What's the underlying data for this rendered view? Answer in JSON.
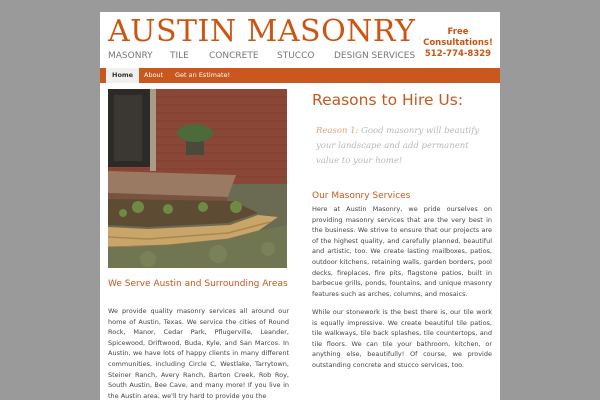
{
  "site": {
    "title": "AUSTIN MASONRY",
    "tagline": [
      "MASONRY",
      "TILE",
      "CONCRETE",
      "STUCCO",
      "DESIGN SERVICES"
    ],
    "cta": [
      "Free",
      "Consultations!",
      "512-774-8329"
    ],
    "colors": {
      "accent": "#cc5511",
      "nav_bg": "#c8581e",
      "page_bg": "#9a9a9a"
    }
  },
  "nav": {
    "items": [
      "Home",
      "About",
      "Get an Estimate!"
    ],
    "active_index": 0
  },
  "left": {
    "photo_alt": "brick planter and stone-edged garden bed",
    "heading": "We Serve Austin and Surrounding Areas",
    "body": "We provide quality masonry services all around our home of Austin, Texas. We service the cities of Round Rock, Manor, Cedar Park, Pflugerville, Leander, Spicewood, Driftwood, Buda, Kyle, and San Marcos. In Austin, we have lots of happy clients in many different communities, including Circle C, Westlake, Tarrytown, Steiner Ranch, Avery Ranch, Barton Creek, Rob Roy, South Austin, Bee Cave, and many more! If you live in the Austin area, we'll try hard to provide you the"
  },
  "right": {
    "title": "Reasons to Hire Us:",
    "reason_label": "Reason 1:",
    "reason_text": "Good masonry will beautify your landscape and add permanent value to your home!",
    "services_heading": "Our Masonry Services",
    "services_body": "Here at Austin Masonry, we pride ourselves on providing masonry services that are the very best in the business. We strive to ensure that our projects are of the highest quality, and carefully planned, beautiful and artistic, too. We create lasting mailboxes, patios, outdoor kitchens, retaining walls, garden borders, pool decks, fireplaces, fire pits, flagstone patios, built in barbecue grills, ponds, fountains, and unique masonry features such as arches, columns, and mosaics.",
    "stone_body": "While our stonework is the best there is, our tile work is equally impressive. We create beautiful tile patios, tile walkways, tile back splashes, tile countertops, and tile floors. We can tile your bathroom, kitchen, or anything else, beautifully! Of course, we provide outstanding concrete and stucco services, too."
  }
}
